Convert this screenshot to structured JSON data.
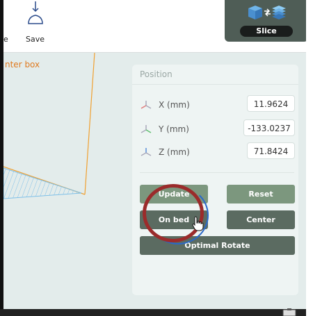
{
  "toolbar": {
    "cut_label": "e",
    "save_label": "Save",
    "slice_label": "Slice"
  },
  "viewport": {
    "object_label": "nter box"
  },
  "position_panel": {
    "title": "Position",
    "rows": [
      {
        "label": "X (mm)",
        "value": "11.9624"
      },
      {
        "label": "Y (mm)",
        "value": "-133.0237"
      },
      {
        "label": "Z (mm)",
        "value": "71.8424"
      }
    ],
    "buttons": {
      "update": "Update",
      "reset": "Reset",
      "on_bed": "On bed",
      "center": "Center",
      "optimal_rotate": "Optimal Rotate"
    }
  },
  "colors": {
    "panel_bg": "#eef4f3",
    "button_light": "#7c977e",
    "button_dark": "#5b6b61",
    "object_label": "#e07a1f",
    "highlight": "#9b2b2b"
  },
  "icons": [
    "save-icon",
    "slice-cube-icon",
    "slice-layers-icon",
    "axis-icon",
    "hand-cursor-icon"
  ]
}
